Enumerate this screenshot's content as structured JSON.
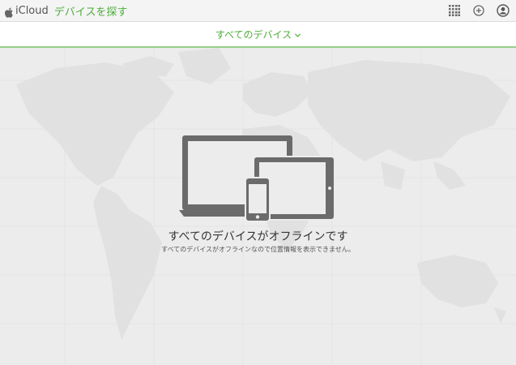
{
  "header": {
    "brand_icloud": "iCloud",
    "app_title": "デバイスを探す"
  },
  "subheader": {
    "device_selector_label": "すべてのデバイス"
  },
  "main": {
    "offline_title": "すべてのデバイスがオフラインです",
    "offline_message": "すべてのデバイスがオフラインなので位置情報を表示できません。"
  },
  "colors": {
    "accent": "#4dae3b"
  }
}
